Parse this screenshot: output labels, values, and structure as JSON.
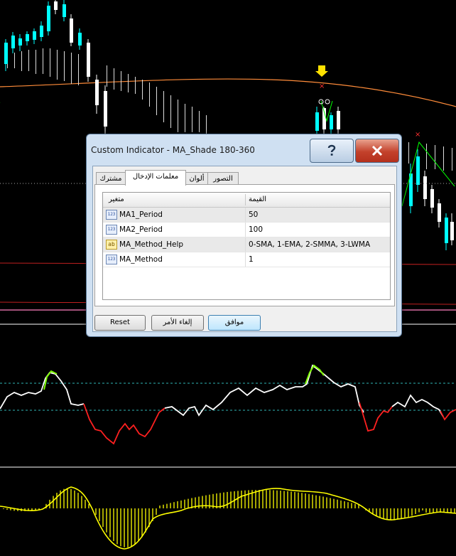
{
  "window": {
    "title": "Custom Indicator - MA_Shade 180-360",
    "help_icon": "question-mark-icon",
    "close_icon": "close-x-icon"
  },
  "tabs": [
    {
      "label": "مشترك",
      "active": false
    },
    {
      "label": "معلمات الإدخال",
      "active": true
    },
    {
      "label": "ألوان",
      "active": false
    },
    {
      "label": "التصور",
      "active": false
    }
  ],
  "grid": {
    "header_variable": "متغير",
    "header_value": "القيمة",
    "rows": [
      {
        "icon": "123",
        "name": "MA1_Period",
        "value": "50"
      },
      {
        "icon": "123",
        "name": "MA2_Period",
        "value": "100"
      },
      {
        "icon": "ab",
        "name": "MA_Method_Help",
        "value": "0-SMA, 1-EMA, 2-SMMA, 3-LWMA"
      },
      {
        "icon": "123",
        "name": "MA_Method",
        "value": "1"
      }
    ]
  },
  "buttons": {
    "reset": "Reset",
    "cancel": "إلغاء الأمر",
    "ok": "موافق"
  },
  "colors": {
    "chart_background": "#000000",
    "bull_candle": "#00ffff",
    "bear_candle": "#ffffff",
    "moving_average": "#ff8c3a",
    "oscillator_up": "#ffffff",
    "oscillator_down": "#ff2020",
    "oscillator_peak": "#7fff00",
    "histogram": "#ffff00",
    "annotation": "#ff0000",
    "arrow_marker": "#ffe100"
  }
}
